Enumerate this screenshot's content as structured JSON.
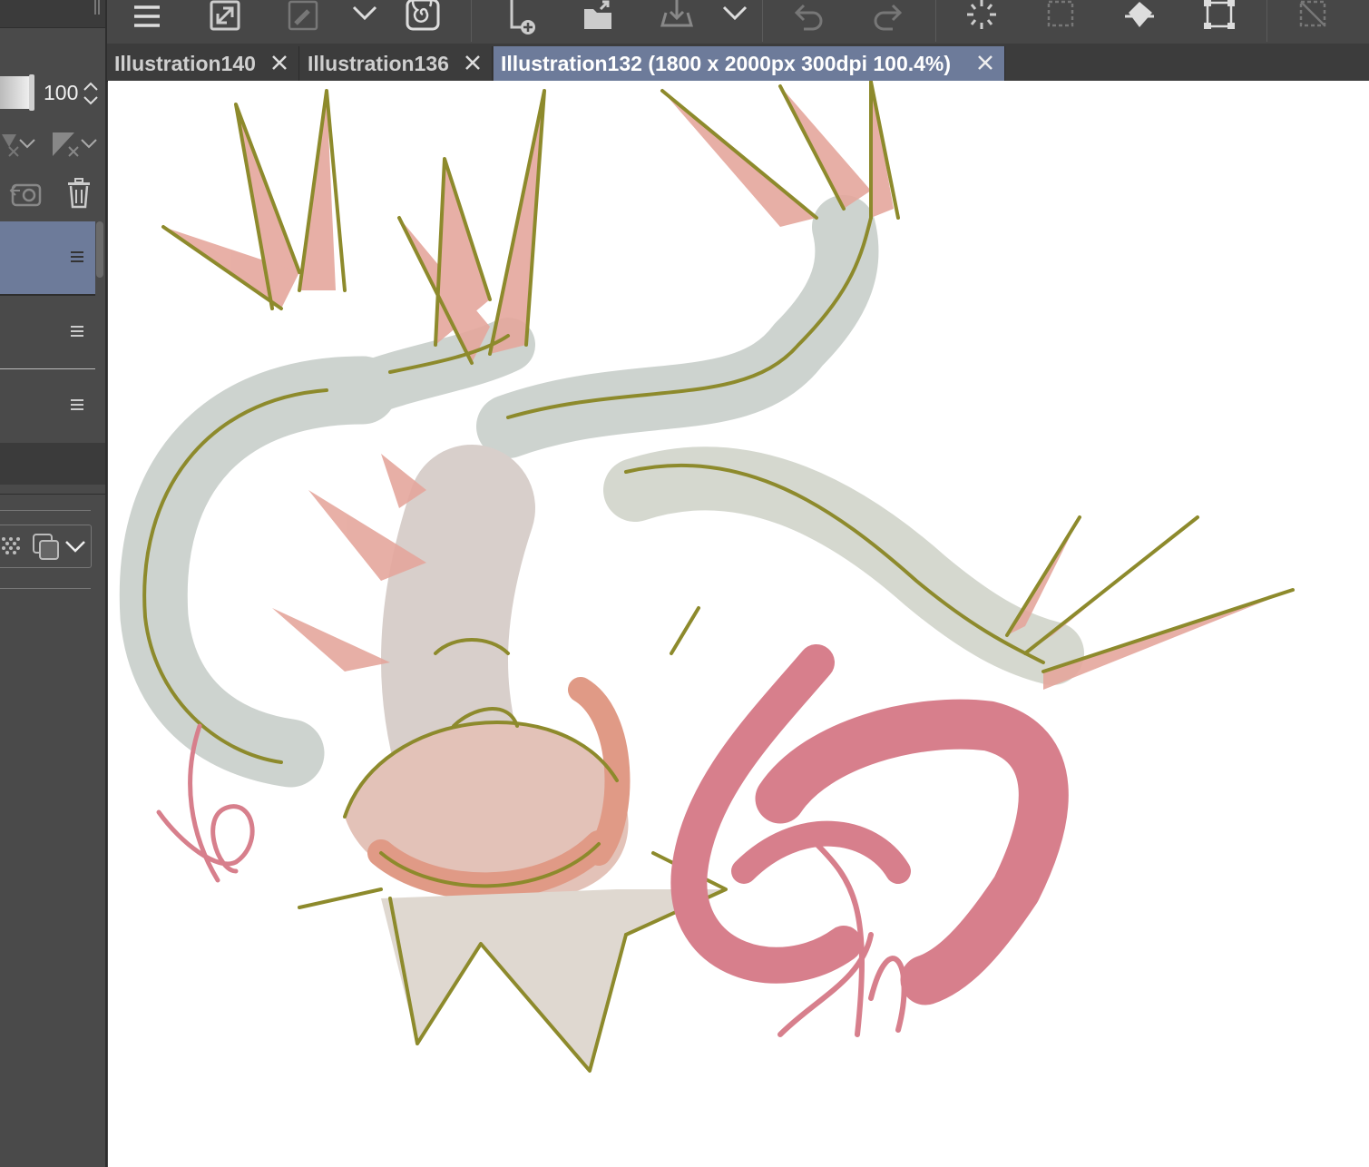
{
  "tabs": [
    {
      "label": "Illustration140",
      "active": false
    },
    {
      "label": "Illustration136",
      "active": false
    },
    {
      "label": "Illustration132 (1800 x 2000px 300dpi 100.4%)",
      "active": true
    }
  ],
  "layer_panel": {
    "opacity_value": "100",
    "layers": [
      {
        "selected": true
      },
      {
        "selected": false
      },
      {
        "selected": false
      }
    ]
  },
  "toolbar_icons": [
    "menu-icon",
    "resize-icon",
    "eyedropper-icon",
    "chevron-down-icon",
    "spiral-icon",
    "new-file-icon",
    "open-folder-icon",
    "export-icon",
    "chevron-down-icon",
    "undo-icon",
    "redo-icon",
    "loading-icon",
    "selection-icon",
    "fill-icon",
    "transform-icon",
    "deselect-icon"
  ],
  "colors": {
    "active_tab": "#6d7b9a",
    "selected_layer": "#6d7b9a",
    "line_art": "#8d8a2c",
    "pink_stroke": "#d77f8c",
    "fill_pink": "#e5a79d",
    "fill_grey": "#cdd3cf"
  }
}
